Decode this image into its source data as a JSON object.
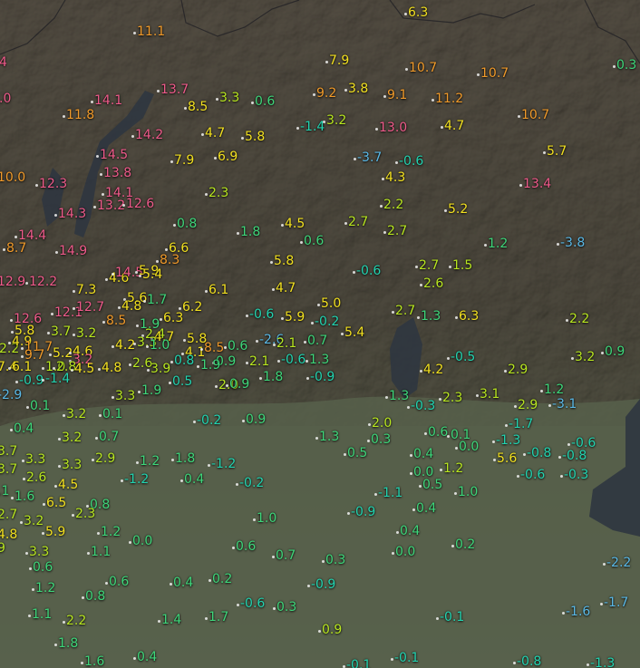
{
  "map": {
    "layer": "temperature",
    "legend_colors": {
      "cold": "#5ab8e6",
      "cool": "#22d3b0",
      "mild": "#3ed67a",
      "warm": "#b8e620",
      "hot": "#f2e020",
      "veryhot": "#f09a2a",
      "hottest": "#ee5a8a"
    },
    "stations": [
      {
        "v": "6.3",
        "c": "hot"
      },
      {
        "v": "11.1",
        "c": "veryhot"
      },
      {
        "v": "4",
        "c": "hottest"
      },
      {
        "v": "7.9",
        "c": "hot"
      },
      {
        "v": "10.7",
        "c": "veryhot"
      },
      {
        "v": "10.7",
        "c": "veryhot"
      },
      {
        "v": "0.3",
        "c": "mild"
      },
      {
        "v": ".0",
        "c": "hottest"
      },
      {
        "v": "14.1",
        "c": "hottest"
      },
      {
        "v": "13.7",
        "c": "hottest"
      },
      {
        "v": "3.3",
        "c": "warm"
      },
      {
        "v": "8.5",
        "c": "hot"
      },
      {
        "v": "0.6",
        "c": "mild"
      },
      {
        "v": "9.2",
        "c": "veryhot"
      },
      {
        "v": "3.8",
        "c": "hot"
      },
      {
        "v": "9.1",
        "c": "veryhot"
      },
      {
        "v": "11.2",
        "c": "veryhot"
      },
      {
        "v": "11.8",
        "c": "veryhot"
      },
      {
        "v": "-1.4",
        "c": "cool"
      },
      {
        "v": "3.2",
        "c": "warm"
      },
      {
        "v": "13.0",
        "c": "hottest"
      },
      {
        "v": "4.7",
        "c": "hot"
      },
      {
        "v": "10.7",
        "c": "veryhot"
      },
      {
        "v": "14.2",
        "c": "hottest"
      },
      {
        "v": "4.7",
        "c": "hot"
      },
      {
        "v": "5.8",
        "c": "hot"
      },
      {
        "v": "-3.7",
        "c": "cold"
      },
      {
        "v": "-0.6",
        "c": "cool"
      },
      {
        "v": "5.7",
        "c": "hot"
      },
      {
        "v": "14.5",
        "c": "hottest"
      },
      {
        "v": "7.9",
        "c": "hot"
      },
      {
        "v": "6.9",
        "c": "hot"
      },
      {
        "v": "13.8",
        "c": "hottest"
      },
      {
        "v": "4.3",
        "c": "hot"
      },
      {
        "v": "10.0",
        "c": "veryhot"
      },
      {
        "v": "12.3",
        "c": "hottest"
      },
      {
        "v": "13.4",
        "c": "hottest"
      },
      {
        "v": "14.1",
        "c": "hottest"
      },
      {
        "v": "2.3",
        "c": "warm"
      },
      {
        "v": "13.2",
        "c": "hottest"
      },
      {
        "v": "12.6",
        "c": "hottest"
      },
      {
        "v": "2.2",
        "c": "warm"
      },
      {
        "v": "5.2",
        "c": "hot"
      },
      {
        "v": "14.3",
        "c": "hottest"
      },
      {
        "v": "0.8",
        "c": "mild"
      },
      {
        "v": "1.8",
        "c": "mild"
      },
      {
        "v": "4.5",
        "c": "hot"
      },
      {
        "v": "2.7",
        "c": "warm"
      },
      {
        "v": "2.7",
        "c": "warm"
      },
      {
        "v": "14.4",
        "c": "hottest"
      },
      {
        "v": "0.6",
        "c": "mild"
      },
      {
        "v": "1.2",
        "c": "mild"
      },
      {
        "v": "-3.8",
        "c": "cold"
      },
      {
        "v": "8.7",
        "c": "veryhot"
      },
      {
        "v": "14.9",
        "c": "hottest"
      },
      {
        "v": "6.6",
        "c": "hot"
      },
      {
        "v": "8.3",
        "c": "veryhot"
      },
      {
        "v": "5.8",
        "c": "hot"
      },
      {
        "v": "-0.6",
        "c": "cool"
      },
      {
        "v": "2.7",
        "c": "warm"
      },
      {
        "v": "1.5",
        "c": "warm"
      },
      {
        "v": "4.6",
        "c": "hot"
      },
      {
        "v": "14.5",
        "c": "hottest"
      },
      {
        "v": "5.9",
        "c": "hot"
      },
      {
        "v": "5.4",
        "c": "hot"
      },
      {
        "v": "12.2",
        "c": "hottest"
      },
      {
        "v": "6.1",
        "c": "hot"
      },
      {
        "v": "4.7",
        "c": "hot"
      },
      {
        "v": "2.6",
        "c": "warm"
      },
      {
        "v": "7.3",
        "c": "hot"
      },
      {
        "v": "12.9",
        "c": "hottest"
      },
      {
        "v": "5.6",
        "c": "hot"
      },
      {
        "v": "1.7",
        "c": "mild"
      },
      {
        "v": "4.8",
        "c": "hot"
      },
      {
        "v": "5.0",
        "c": "hot"
      },
      {
        "v": "6.2",
        "c": "hot"
      },
      {
        "v": "-0.6",
        "c": "cool"
      },
      {
        "v": "2.7",
        "c": "warm"
      },
      {
        "v": "1.3",
        "c": "mild"
      },
      {
        "v": "6.3",
        "c": "hot"
      },
      {
        "v": "12.1",
        "c": "hottest"
      },
      {
        "v": "12.7",
        "c": "hottest"
      },
      {
        "v": "12.6",
        "c": "hottest"
      },
      {
        "v": "8.5",
        "c": "veryhot"
      },
      {
        "v": "1.9",
        "c": "mild"
      },
      {
        "v": "6.3",
        "c": "hot"
      },
      {
        "v": "5.9",
        "c": "hot"
      },
      {
        "v": "-0.2",
        "c": "cool"
      },
      {
        "v": "2.2",
        "c": "warm"
      },
      {
        "v": "3.7",
        "c": "warm"
      },
      {
        "v": "3.2",
        "c": "warm"
      },
      {
        "v": "5.4",
        "c": "hot"
      },
      {
        "v": "5.8",
        "c": "hot"
      },
      {
        "v": "2.4",
        "c": "warm"
      },
      {
        "v": "4.7",
        "c": "hot"
      },
      {
        "v": "5.8",
        "c": "hot"
      },
      {
        "v": "-2.6",
        "c": "cold"
      },
      {
        "v": "0.7",
        "c": "mild"
      },
      {
        "v": "2.2",
        "c": "warm"
      },
      {
        "v": "4.9",
        "c": "hot"
      },
      {
        "v": "11.7",
        "c": "veryhot"
      },
      {
        "v": "4.2",
        "c": "hot"
      },
      {
        "v": "3.3",
        "c": "warm"
      },
      {
        "v": "2.1",
        "c": "warm"
      },
      {
        "v": "5.2",
        "c": "hot"
      },
      {
        "v": "4.6",
        "c": "hot"
      },
      {
        "v": "1.0",
        "c": "mild"
      },
      {
        "v": "4.1",
        "c": "hot"
      },
      {
        "v": "8.5",
        "c": "veryhot"
      },
      {
        "v": "0.6",
        "c": "mild"
      },
      {
        "v": "-0.5",
        "c": "cool"
      },
      {
        "v": "2.9",
        "c": "warm"
      },
      {
        "v": "3.2",
        "c": "warm"
      },
      {
        "v": "0.9",
        "c": "mild"
      },
      {
        "v": "9.7",
        "c": "veryhot"
      },
      {
        "v": "3.2",
        "c": "hottest"
      },
      {
        "v": "0.8",
        "c": "cool"
      },
      {
        "v": "0.9",
        "c": "mild"
      },
      {
        "v": "2.1",
        "c": "warm"
      },
      {
        "v": "-0.6",
        "c": "cool"
      },
      {
        "v": "1.3",
        "c": "mild"
      },
      {
        "v": "7.4",
        "c": "hot"
      },
      {
        "v": "6.1",
        "c": "hot"
      },
      {
        "v": "1.0",
        "c": "warm"
      },
      {
        "v": "2.8",
        "c": "warm"
      },
      {
        "v": "4.5",
        "c": "hot"
      },
      {
        "v": "4.8",
        "c": "hot"
      },
      {
        "v": "2.6",
        "c": "warm"
      },
      {
        "v": "3.9",
        "c": "warm"
      },
      {
        "v": "1.9",
        "c": "mild"
      },
      {
        "v": "2.0",
        "c": "warm"
      },
      {
        "v": "4.2",
        "c": "hot"
      },
      {
        "v": "-0.9",
        "c": "cool"
      },
      {
        "v": "-1.4",
        "c": "cool"
      },
      {
        "v": "0.5",
        "c": "cool"
      },
      {
        "v": "0.9",
        "c": "mild"
      },
      {
        "v": "1.8",
        "c": "mild"
      },
      {
        "v": "-0.9",
        "c": "cool"
      },
      {
        "v": "1.2",
        "c": "mild"
      },
      {
        "v": "-2.9",
        "c": "cold"
      },
      {
        "v": "0.1",
        "c": "mild"
      },
      {
        "v": "3.3",
        "c": "warm"
      },
      {
        "v": "1.9",
        "c": "mild"
      },
      {
        "v": "1.3",
        "c": "mild"
      },
      {
        "v": "-0.3",
        "c": "cool"
      },
      {
        "v": "2.3",
        "c": "warm"
      },
      {
        "v": "3.1",
        "c": "warm"
      },
      {
        "v": "2.9",
        "c": "warm"
      },
      {
        "v": "-3.1",
        "c": "cold"
      },
      {
        "v": "3.2",
        "c": "warm"
      },
      {
        "v": "0.1",
        "c": "mild"
      },
      {
        "v": "-0.2",
        "c": "cool"
      },
      {
        "v": "0.9",
        "c": "mild"
      },
      {
        "v": "2.0",
        "c": "warm"
      },
      {
        "v": "-1.7",
        "c": "cool"
      },
      {
        "v": "0.4",
        "c": "mild"
      },
      {
        "v": "1.3",
        "c": "mild"
      },
      {
        "v": "0.3",
        "c": "mild"
      },
      {
        "v": "0.6",
        "c": "mild"
      },
      {
        "v": "0.1",
        "c": "mild"
      },
      {
        "v": "3.2",
        "c": "warm"
      },
      {
        "v": "0.7",
        "c": "mild"
      },
      {
        "v": "-1.3",
        "c": "cool"
      },
      {
        "v": "-0.6",
        "c": "cool"
      },
      {
        "v": "3.7",
        "c": "warm"
      },
      {
        "v": "0.5",
        "c": "mild"
      },
      {
        "v": "0.4",
        "c": "mild"
      },
      {
        "v": "0.0",
        "c": "mild"
      },
      {
        "v": "-0.8",
        "c": "cool"
      },
      {
        "v": "-0.8",
        "c": "cool"
      },
      {
        "v": "2.9",
        "c": "warm"
      },
      {
        "v": "1.2",
        "c": "mild"
      },
      {
        "v": "1.8",
        "c": "mild"
      },
      {
        "v": "-1.2",
        "c": "cool"
      },
      {
        "v": "5.6",
        "c": "hot"
      },
      {
        "v": "3.7",
        "c": "warm"
      },
      {
        "v": "3.3",
        "c": "warm"
      },
      {
        "v": "3.3",
        "c": "warm"
      },
      {
        "v": "0.0",
        "c": "mild"
      },
      {
        "v": "1.2",
        "c": "warm"
      },
      {
        "v": "-0.6",
        "c": "cool"
      },
      {
        "v": "-0.3",
        "c": "cool"
      },
      {
        "v": "-1.2",
        "c": "cool"
      },
      {
        "v": "0.4",
        "c": "mild"
      },
      {
        "v": "-0.2",
        "c": "cool"
      },
      {
        "v": "2.6",
        "c": "warm"
      },
      {
        "v": "0.5",
        "c": "mild"
      },
      {
        "v": "4.5",
        "c": "hot"
      },
      {
        "v": "1.0",
        "c": "mild"
      },
      {
        "v": "-1.1",
        "c": "cool"
      },
      {
        "v": ".1",
        "c": "mild"
      },
      {
        "v": "1.6",
        "c": "mild"
      },
      {
        "v": "0.8",
        "c": "mild"
      },
      {
        "v": "6.5",
        "c": "hot"
      },
      {
        "v": "0.4",
        "c": "mild"
      },
      {
        "v": "2.7",
        "c": "warm"
      },
      {
        "v": "2.3",
        "c": "warm"
      },
      {
        "v": "1.0",
        "c": "mild"
      },
      {
        "v": "-0.9",
        "c": "cool"
      },
      {
        "v": "3.2",
        "c": "warm"
      },
      {
        "v": "5.9",
        "c": "hot"
      },
      {
        "v": "1.2",
        "c": "mild"
      },
      {
        "v": "0.4",
        "c": "mild"
      },
      {
        "v": "4.8",
        "c": "hot"
      },
      {
        "v": "0.0",
        "c": "mild"
      },
      {
        "v": "0.2",
        "c": "mild"
      },
      {
        "v": "9",
        "c": "warm"
      },
      {
        "v": "3.3",
        "c": "warm"
      },
      {
        "v": "1.1",
        "c": "mild"
      },
      {
        "v": "0.6",
        "c": "mild"
      },
      {
        "v": "0.7",
        "c": "mild"
      },
      {
        "v": "0.3",
        "c": "mild"
      },
      {
        "v": "0.0",
        "c": "mild"
      },
      {
        "v": "-2.2",
        "c": "cold"
      },
      {
        "v": "0.6",
        "c": "mild"
      },
      {
        "v": "0.6",
        "c": "mild"
      },
      {
        "v": "0.4",
        "c": "mild"
      },
      {
        "v": "0.2",
        "c": "mild"
      },
      {
        "v": "-0.9",
        "c": "cool"
      },
      {
        "v": "1.2",
        "c": "mild"
      },
      {
        "v": "0.8",
        "c": "mild"
      },
      {
        "v": "-0.6",
        "c": "cool"
      },
      {
        "v": "0.3",
        "c": "mild"
      },
      {
        "v": "-1.6",
        "c": "cold"
      },
      {
        "v": "-1.7",
        "c": "cold"
      },
      {
        "v": "1.1",
        "c": "mild"
      },
      {
        "v": "2.2",
        "c": "warm"
      },
      {
        "v": "1.4",
        "c": "mild"
      },
      {
        "v": "1.7",
        "c": "mild"
      },
      {
        "v": "-0.1",
        "c": "cool"
      },
      {
        "v": "0.9",
        "c": "warm"
      },
      {
        "v": "1.8",
        "c": "mild"
      },
      {
        "v": "1.6",
        "c": "mild"
      },
      {
        "v": "0.4",
        "c": "mild"
      },
      {
        "v": "-0.1",
        "c": "cool"
      },
      {
        "v": "-0.1",
        "c": "cool"
      },
      {
        "v": "-0.8",
        "c": "cool"
      },
      {
        "v": "-1.3",
        "c": "cool"
      }
    ]
  }
}
